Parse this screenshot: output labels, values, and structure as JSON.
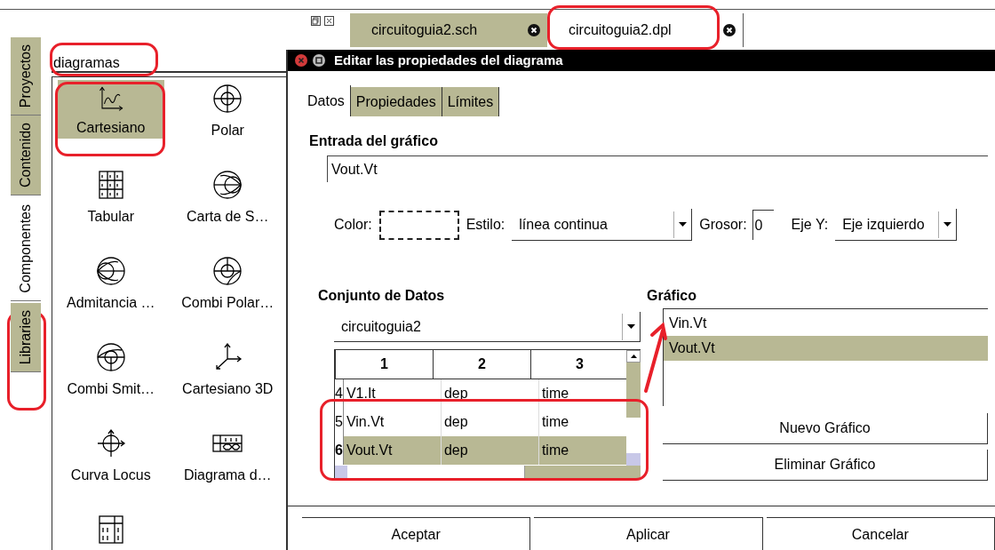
{
  "sidebar_tabs": [
    {
      "label": "Proyectos",
      "selected": false
    },
    {
      "label": "Contenido",
      "selected": false
    },
    {
      "label": "Componentes",
      "selected": true
    },
    {
      "label": "Libraries",
      "selected": false
    }
  ],
  "search": {
    "value": "diagramas"
  },
  "components": [
    {
      "label": "Cartesiano",
      "kind": "cartesian",
      "selected": true
    },
    {
      "label": "Polar",
      "kind": "polar",
      "selected": false
    },
    {
      "label": "Tabular",
      "kind": "tabular",
      "selected": false
    },
    {
      "label": "Carta de S…",
      "kind": "smith",
      "selected": false
    },
    {
      "label": "Admitancia …",
      "kind": "admittance",
      "selected": false
    },
    {
      "label": "Combi Polar…",
      "kind": "polarsmith",
      "selected": false
    },
    {
      "label": "Combi Smit…",
      "kind": "smithpolar",
      "selected": false
    },
    {
      "label": "Cartesiano 3D",
      "kind": "cart3d",
      "selected": false
    },
    {
      "label": "Curva Locus",
      "kind": "locus",
      "selected": false
    },
    {
      "label": "Diagrama d…",
      "kind": "timing",
      "selected": false
    },
    {
      "kind": "truth",
      "selected": false
    }
  ],
  "document_tabs": [
    {
      "label": "circuitoguia2.sch",
      "selected": false
    },
    {
      "label": "circuitoguia2.dpl",
      "selected": true
    }
  ],
  "dialog": {
    "title": "Editar las propiedades del diagrama",
    "tabs": [
      {
        "label": "Datos",
        "selected": true
      },
      {
        "label": "Propiedades",
        "selected": false
      },
      {
        "label": "Límites",
        "selected": false
      }
    ],
    "section_title": "Entrada del gráfico",
    "graph_input": "Vout.Vt",
    "color_label": "Color:",
    "style_label": "Estilo:",
    "style_value": "línea continua",
    "width_label": "Grosor:",
    "width_value": "0",
    "axis_label": "Eje Y:",
    "axis_value": "Eje izquierdo",
    "dataset": {
      "title": "Conjunto de Datos",
      "select_value": "circuitoguia2",
      "columns": [
        "1",
        "2",
        "3"
      ],
      "rows": [
        {
          "number": "4",
          "cells": [
            "V1.It",
            "dep",
            "time"
          ],
          "selected": false
        },
        {
          "number": "5",
          "cells": [
            "Vin.Vt",
            "dep",
            "time"
          ],
          "selected": false
        },
        {
          "number": "6",
          "cells": [
            "Vout.Vt",
            "dep",
            "time"
          ],
          "selected": true
        }
      ]
    },
    "graph": {
      "title": "Gráfico",
      "items": [
        {
          "label": "Vin.Vt",
          "selected": false
        },
        {
          "label": "Vout.Vt",
          "selected": true
        }
      ],
      "buttons": [
        "Nuevo Gráfico",
        "Eliminar Gráfico"
      ]
    },
    "buttons": [
      "Aceptar",
      "Aplicar",
      "Cancelar"
    ]
  }
}
